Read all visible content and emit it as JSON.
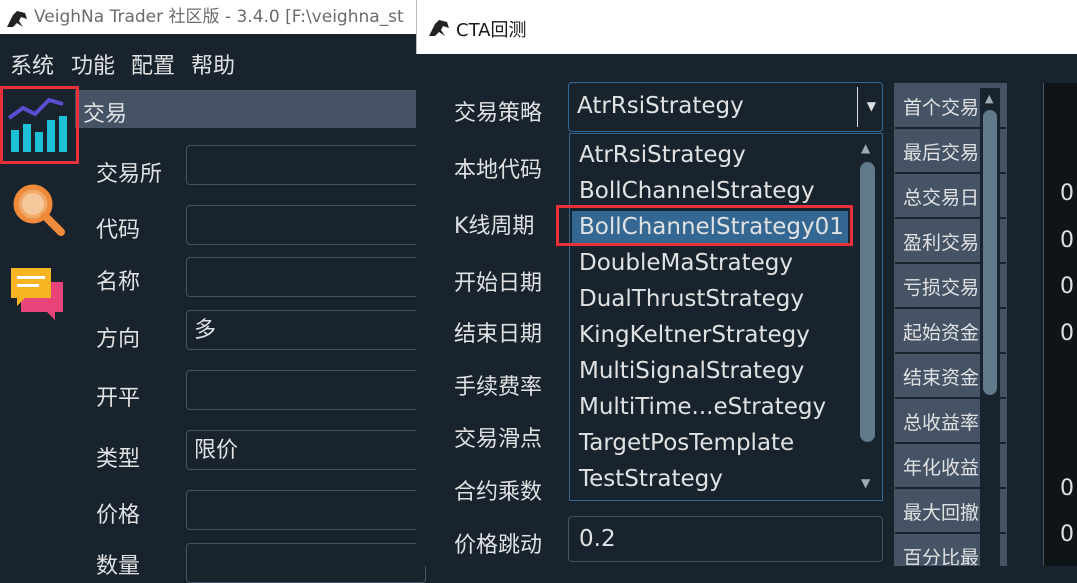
{
  "main_window": {
    "title": "VeighNa Trader 社区版 - 3.4.0   [F:\\veighna_st",
    "menu": [
      "系统",
      "功能",
      "配置",
      "帮助"
    ],
    "sidebar_icons": [
      "trading-chart-icon",
      "search-icon",
      "chat-icon"
    ],
    "panel_title": "交易",
    "form": {
      "exchange_label": "交易所",
      "symbol_label": "代码",
      "name_label": "名称",
      "direction_label": "方向",
      "direction_value": "多",
      "offset_label": "开平",
      "type_label": "类型",
      "type_value": "限价",
      "price_label": "价格",
      "volume_label": "数量"
    }
  },
  "cta_window": {
    "title": "CTA回测",
    "labels": {
      "strategy": "交易策略",
      "vt_symbol": "本地代码",
      "interval": "K线周期",
      "start_date": "开始日期",
      "end_date": "结束日期",
      "rate": "手续费率",
      "slippage": "交易滑点",
      "size": "合约乘数",
      "pricetick": "价格跳动"
    },
    "strategy_selected": "AtrRsiStrategy",
    "pricetick_value": "0.2",
    "dropdown_options": [
      "AtrRsiStrategy",
      "BollChannelStrategy",
      "BollChannelStrategy01",
      "DoubleMaStrategy",
      "DualThrustStrategy",
      "KingKeltnerStrategy",
      "MultiSignalStrategy",
      "MultiTime...eStrategy",
      "TargetPosTemplate",
      "TestStrategy"
    ],
    "dropdown_highlighted": "BollChannelStrategy01",
    "stats_rows": [
      "首个交易",
      "最后交易",
      "总交易日",
      "盈利交易",
      "亏损交易",
      "起始资金",
      "结束资金",
      "总收益率",
      "年化收益",
      "最大回撤",
      "百分比最"
    ],
    "stats_values": [
      "0",
      "0",
      "0",
      "0",
      "0",
      "0"
    ]
  },
  "colors": {
    "background": "#19232d",
    "selection": "#346792",
    "highlight_box": "#e8303a"
  }
}
